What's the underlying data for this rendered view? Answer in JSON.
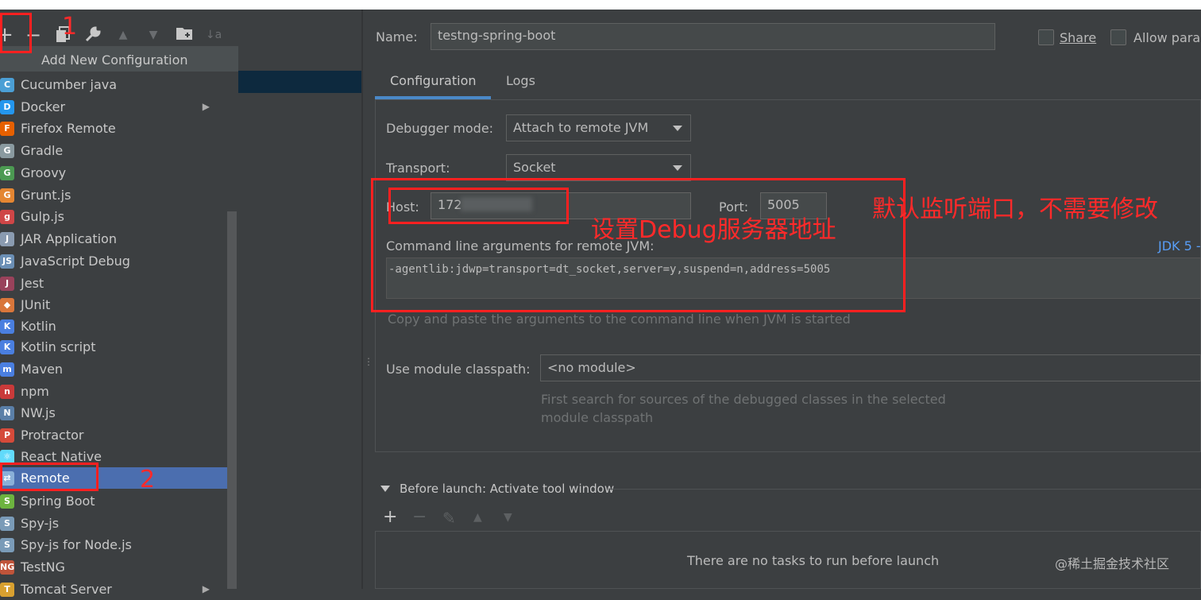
{
  "toolbar": {
    "add_icon": "+",
    "remove_icon": "−",
    "copy_icon": "copy-icon",
    "settings_icon": "wrench-icon",
    "up_icon": "▲",
    "down_icon": "▼",
    "folder_icon": "folder-icon",
    "sort_icon": "↓a"
  },
  "popup": {
    "header": "Add New Configuration",
    "items": [
      {
        "label": "Cucumber java",
        "icon": "cucumber-icon",
        "color": "#4b9fd5"
      },
      {
        "label": "Docker",
        "icon": "docker-icon",
        "color": "#2496ed",
        "submenu": "▶"
      },
      {
        "label": "Firefox Remote",
        "icon": "firefox-icon",
        "color": "#e66000"
      },
      {
        "label": "Gradle",
        "icon": "gradle-icon",
        "color": "#8a9aa0"
      },
      {
        "label": "Groovy",
        "icon": "groovy-icon",
        "color": "#4c9a52"
      },
      {
        "label": "Grunt.js",
        "icon": "grunt-icon",
        "color": "#e48632"
      },
      {
        "label": "Gulp.js",
        "icon": "gulp-icon",
        "color": "#cf4647"
      },
      {
        "label": "JAR Application",
        "icon": "jar-icon",
        "color": "#8a9bb0"
      },
      {
        "label": "JavaScript Debug",
        "icon": "js-debug-icon",
        "color": "#6b8fb5"
      },
      {
        "label": "Jest",
        "icon": "jest-icon",
        "color": "#99425b"
      },
      {
        "label": "JUnit",
        "icon": "junit-icon",
        "color": "#d9763b"
      },
      {
        "label": "Kotlin",
        "icon": "kotlin-icon",
        "color": "#4a7fe0"
      },
      {
        "label": "Kotlin script",
        "icon": "kotlin-script-icon",
        "color": "#4a7fe0"
      },
      {
        "label": "Maven",
        "icon": "maven-icon",
        "color": "#4a7fe0"
      },
      {
        "label": "npm",
        "icon": "npm-icon",
        "color": "#c93a3a"
      },
      {
        "label": "NW.js",
        "icon": "nwjs-icon",
        "color": "#5a7fa8"
      },
      {
        "label": "Protractor",
        "icon": "protractor-icon",
        "color": "#d54a3a"
      },
      {
        "label": "React Native",
        "icon": "react-icon",
        "color": "#61dafb"
      },
      {
        "label": "Remote",
        "icon": "remote-icon",
        "color": "#8ab0d8",
        "selected": true
      },
      {
        "label": "Spring Boot",
        "icon": "spring-boot-icon",
        "color": "#6db33f"
      },
      {
        "label": "Spy-js",
        "icon": "spyjs-icon",
        "color": "#7a9bb8"
      },
      {
        "label": "Spy-js for Node.js",
        "icon": "spyjs-node-icon",
        "color": "#7a9bb8"
      },
      {
        "label": "TestNG",
        "icon": "testng-icon",
        "color": "#c0543a"
      },
      {
        "label": "Tomcat Server",
        "icon": "tomcat-icon",
        "color": "#d8a030",
        "submenu": "▶"
      }
    ]
  },
  "form": {
    "name_label": "Name:",
    "name_value": "testng-spring-boot",
    "share_label": "Share",
    "allow_label": "Allow para",
    "tabs": [
      "Configuration",
      "Logs"
    ],
    "debugger_mode_label": "Debugger mode:",
    "debugger_mode_value": "Attach to remote JVM",
    "transport_label": "Transport:",
    "transport_value": "Socket",
    "host_label": "Host:",
    "host_value": "172",
    "port_label": "Port:",
    "port_value": "5005",
    "cmd_label": "Command line arguments for remote JVM:",
    "jdk_link": "JDK 5 -",
    "cmd_value": "-agentlib:jdwp=transport=dt_socket,server=y,suspend=n,address=5005",
    "cmd_hint": "Copy and paste the arguments to the command line when JVM is started",
    "module_label": "Use module classpath:",
    "module_value": "<no module>",
    "module_hint_1": "First search for sources of the debugged classes in the selected",
    "module_hint_2": "module classpath"
  },
  "before_launch": {
    "title": "Before launch: Activate tool window",
    "empty_text": "There are no tasks to run before launch",
    "add": "+",
    "remove": "−",
    "edit": "✎",
    "up": "▲",
    "down": "▼"
  },
  "annotations": {
    "num1": "1",
    "num2": "2",
    "debug_address": "设置Debug服务器地址",
    "default_port": "默认监听端口，不需要修改"
  },
  "watermark": "@稀土掘金技术社区",
  "colors": {
    "background": "#3c3f41",
    "selection": "#4b6eaf",
    "tab_accent": "#4a88c7",
    "annotation_red": "#ff2020",
    "link_blue": "#589df6"
  }
}
